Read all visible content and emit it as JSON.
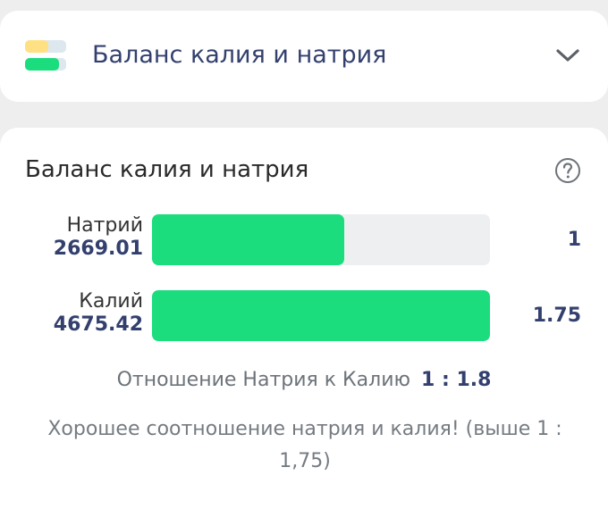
{
  "header": {
    "title": "Баланс калия и натрия"
  },
  "main": {
    "title": "Баланс калия и натрия",
    "rows": [
      {
        "name": "Натрий",
        "amount": "2669.01",
        "ratio": "1",
        "fill_percent": 57
      },
      {
        "name": "Калий",
        "amount": "4675.42",
        "ratio": "1.75",
        "fill_percent": 100
      }
    ],
    "ratio_label": "Отношение Натрия к Калию",
    "ratio_value": "1 : 1.8",
    "message": "Хорошее соотношение натрия и калия! (выше 1 : 1,75)"
  },
  "colors": {
    "bar_fill": "#1bdd7e",
    "bar_track": "#eeeff1",
    "accent_text": "#33406e",
    "icon_yellow": "#ffe082",
    "icon_green": "#1bdd7e",
    "icon_blue": "#dde7ee"
  },
  "icons": {
    "header": "balance-bars-icon",
    "toggle": "chevron-down-icon",
    "help": "question-circle-icon"
  }
}
